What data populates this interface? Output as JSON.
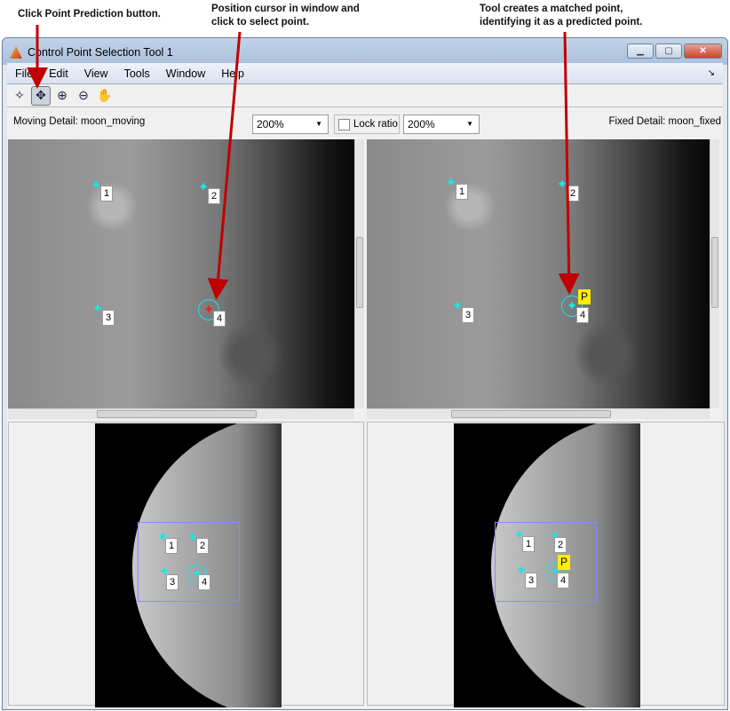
{
  "annotations": [
    "Click Point Prediction button.",
    "Position cursor in window and",
    "click to select point.",
    "Tool creates a matched point,",
    "identifying it as a predicted point."
  ],
  "window": {
    "title": "Control Point Selection Tool 1",
    "minimize": "▁",
    "maximize": "▢",
    "close": "✕"
  },
  "menu": [
    "File",
    "Edit",
    "View",
    "Tools",
    "Window",
    "Help"
  ],
  "menu_dock": "↘",
  "toolbar": [
    {
      "name": "add-point",
      "glyph": "✧"
    },
    {
      "name": "point-prediction",
      "glyph": "✥"
    },
    {
      "name": "zoom-in",
      "glyph": "⊕"
    },
    {
      "name": "zoom-out",
      "glyph": "⊖"
    },
    {
      "name": "pan",
      "glyph": "✋"
    }
  ],
  "moving_label": "Moving Detail: moon_moving",
  "fixed_label": "Fixed Detail: moon_fixed",
  "moving_zoom": "200%",
  "fixed_zoom": "200%",
  "lock_ratio": "Lock ratio",
  "lock_checked": false,
  "points": [
    "1",
    "2",
    "3",
    "4"
  ],
  "predicted_tag": "P",
  "colors": {
    "point": "#19e6e6",
    "predicted": "#ffee00",
    "arrow": "#c00000"
  }
}
